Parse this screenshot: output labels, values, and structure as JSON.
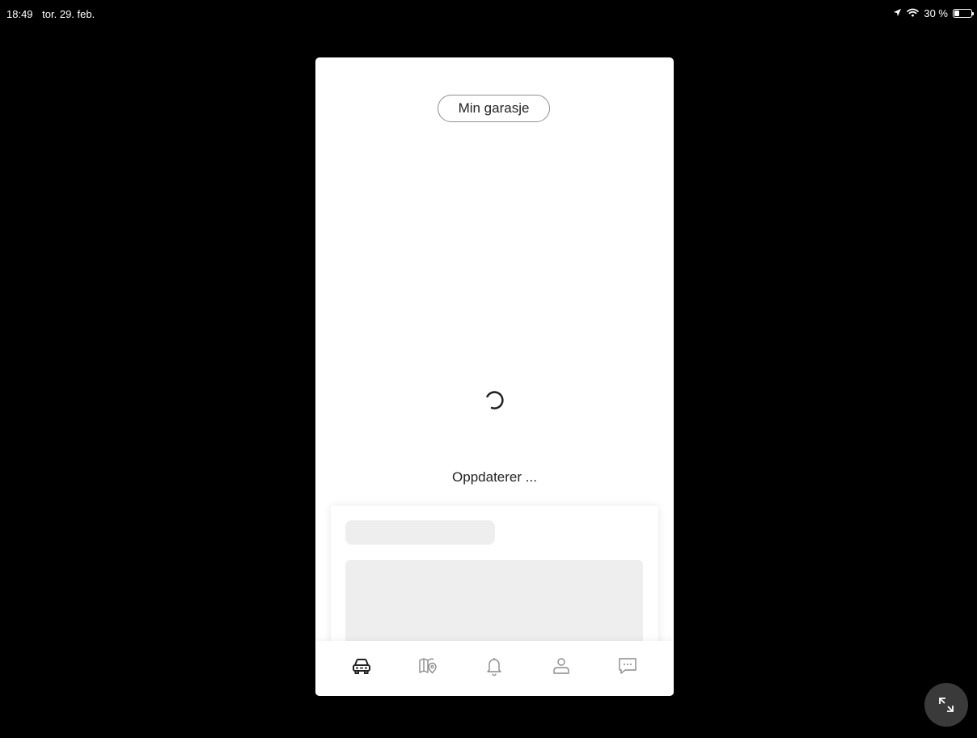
{
  "status_bar": {
    "time": "18:49",
    "date": "tor. 29. feb.",
    "battery_text": "30 %",
    "battery_level": 0.3,
    "icons": [
      "location-arrow-icon",
      "wifi-icon",
      "battery-icon"
    ]
  },
  "app": {
    "header_title": "Min garasje",
    "loading_text": "Oppdaterer ...",
    "tabs": [
      {
        "name": "car",
        "icon": "car-icon",
        "active": true
      },
      {
        "name": "map",
        "icon": "map-pin-icon",
        "active": false
      },
      {
        "name": "notifications",
        "icon": "bell-icon",
        "active": false
      },
      {
        "name": "profile",
        "icon": "person-icon",
        "active": false
      },
      {
        "name": "chat",
        "icon": "chat-bubble-icon",
        "active": false
      }
    ],
    "colors": {
      "active_tab": "#222222",
      "inactive_tab": "#8a8a8a",
      "skeleton": "#eeeeee"
    }
  },
  "overlay": {
    "expand_icon": "expand-arrows-icon"
  }
}
